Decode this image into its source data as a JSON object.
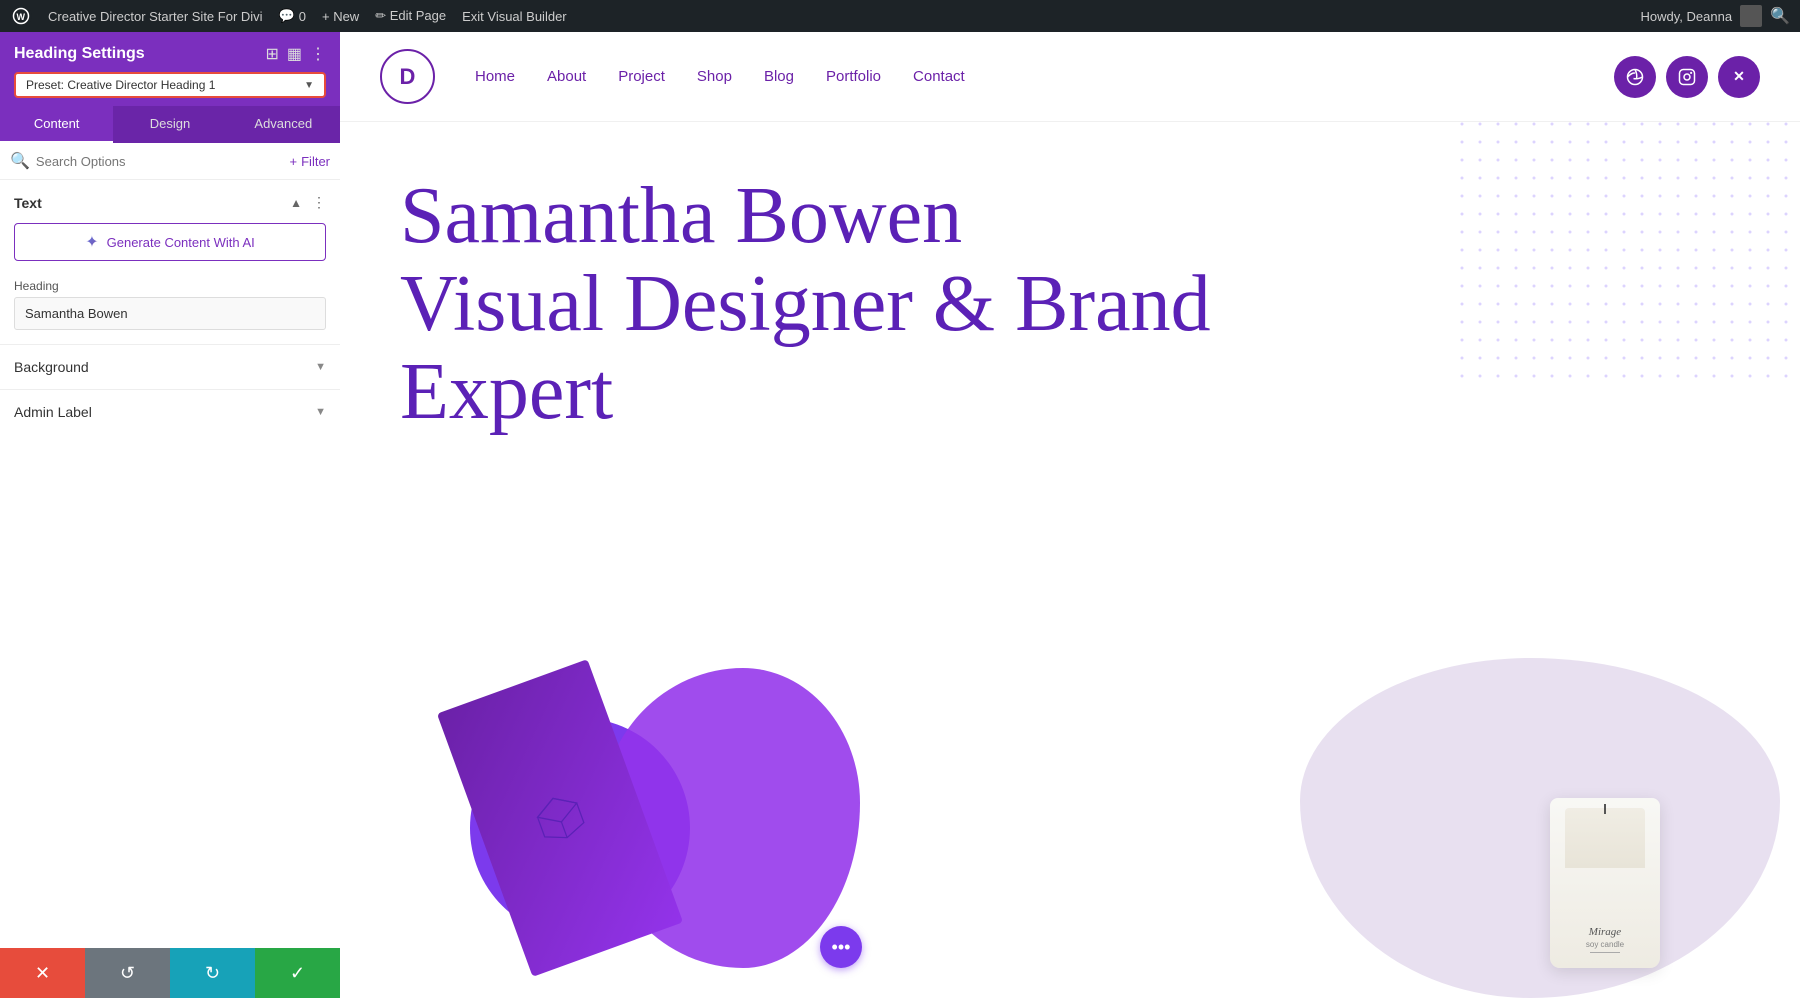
{
  "admin_bar": {
    "wp_icon": "⊕",
    "site_name": "Creative Director Starter Site For Divi",
    "comments_icon": "💬",
    "comments_count": "0",
    "new_label": "+ New",
    "edit_page_label": "✏ Edit Page",
    "exit_builder_label": "Exit Visual Builder",
    "howdy_label": "Howdy, Deanna",
    "search_icon": "🔍"
  },
  "panel": {
    "title": "Heading Settings",
    "preset_label": "Preset: Creative Director Heading 1",
    "icons": {
      "settings": "⊞",
      "layout": "▦",
      "menu": "⋮"
    },
    "tabs": [
      {
        "label": "Content",
        "active": true
      },
      {
        "label": "Design",
        "active": false
      },
      {
        "label": "Advanced",
        "active": false
      }
    ],
    "search_placeholder": "Search Options",
    "filter_label": "+ Filter",
    "text_section_label": "Text",
    "ai_button_label": "Generate Content With AI",
    "heading_field_label": "Heading",
    "heading_value": "Samantha Bowen",
    "background_section_label": "Background",
    "admin_label_section_label": "Admin Label"
  },
  "bottom_bar": {
    "cancel_icon": "✕",
    "undo_icon": "↺",
    "redo_icon": "↻",
    "save_icon": "✓"
  },
  "site": {
    "logo_letter": "D",
    "nav_links": [
      "Home",
      "About",
      "Project",
      "Shop",
      "Blog",
      "Portfolio",
      "Contact"
    ],
    "socials": [
      "⊕",
      "📷",
      "✕"
    ],
    "hero_heading_line1": "Samantha Bowen",
    "hero_heading_line2": "Visual Designer & Brand",
    "hero_heading_line3": "Expert",
    "candle_brand": "Mirage",
    "candle_subtitle": "soy candle"
  },
  "colors": {
    "purple": "#6b21a8",
    "purple_light": "#7c3aed",
    "purple_mid": "#a855f7",
    "admin_bar_bg": "#1d2327",
    "preset_border": "#e74c3c"
  }
}
